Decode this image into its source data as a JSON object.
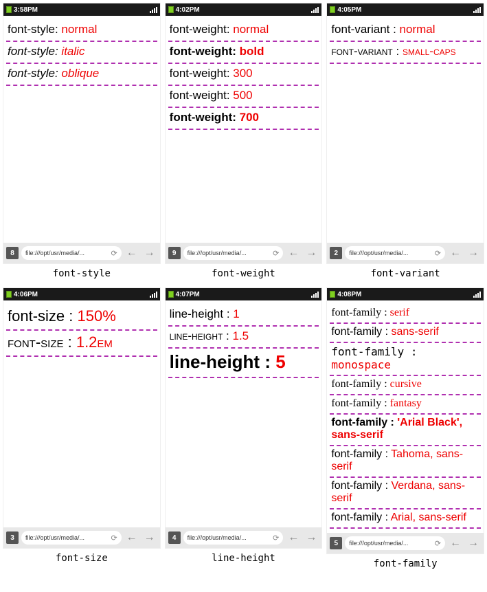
{
  "url": "file:///opt/usr/media/...",
  "screens": [
    {
      "time": "3:58PM",
      "tabs": "8",
      "caption": "font-style",
      "rows": [
        {
          "p": "font-style: ",
          "v": "normal",
          "cls": ""
        },
        {
          "p": "font-style: ",
          "v": "italic",
          "cls": "italic"
        },
        {
          "p": "font-style: ",
          "v": "oblique",
          "cls": "oblique"
        }
      ]
    },
    {
      "time": "4:02PM",
      "tabs": "9",
      "caption": "font-weight",
      "rows": [
        {
          "p": "font-weight: ",
          "v": "normal",
          "cls": ""
        },
        {
          "p": "font-weight: ",
          "v": "bold",
          "cls": "bold"
        },
        {
          "p": "font-weight: ",
          "v": "300",
          "cls": "w300"
        },
        {
          "p": "font-weight: ",
          "v": "500",
          "cls": "w500"
        },
        {
          "p": "font-weight: ",
          "v": "700",
          "cls": "w700"
        }
      ]
    },
    {
      "time": "4:05PM",
      "tabs": "2",
      "caption": "font-variant",
      "rows": [
        {
          "p": "font-variant : ",
          "v": "normal",
          "cls": ""
        },
        {
          "p": "font-variant : ",
          "v": "small-caps",
          "cls": "smallcaps"
        }
      ]
    },
    {
      "time": "4:06PM",
      "tabs": "3",
      "caption": "font-size",
      "rows": [
        {
          "p": "font-size : ",
          "v": "150%",
          "cls": "big"
        },
        {
          "p": "font-size : ",
          "v": "1.2em",
          "cls": "smallcaps big"
        }
      ]
    },
    {
      "time": "4:07PM",
      "tabs": "4",
      "caption": "line-height",
      "rows": [
        {
          "p": "line-height : ",
          "v": "1",
          "cls": ""
        },
        {
          "p": "line-height : ",
          "v": "1.5",
          "cls": "smallcaps"
        },
        {
          "p": "line-height : ",
          "v": "5",
          "cls": "bigger"
        }
      ]
    },
    {
      "time": "4:08PM",
      "tabs": "5",
      "caption": "font-family",
      "tight": true,
      "rows": [
        {
          "p": "font-family : ",
          "v": "serif",
          "cls": "serif"
        },
        {
          "p": "font-family : ",
          "v": "sans-serif",
          "cls": "sans"
        },
        {
          "p": "font-family : ",
          "v": "monospace",
          "cls": "mono"
        },
        {
          "p": "font-family : ",
          "v": "cursive",
          "cls": "cursive"
        },
        {
          "p": "font-family : ",
          "v": "fantasy",
          "cls": "fantasy"
        },
        {
          "p": "font-family : ",
          "v": "'Arial Black', sans-serif",
          "cls": "sans bold"
        },
        {
          "p": "font-family : ",
          "v": "Tahoma, sans-serif",
          "cls": "sans"
        },
        {
          "p": "font-family : ",
          "v": "Verdana, sans-serif",
          "cls": "sans"
        },
        {
          "p": "font-family : ",
          "v": "Arial, sans-serif",
          "cls": "sans"
        }
      ]
    }
  ]
}
